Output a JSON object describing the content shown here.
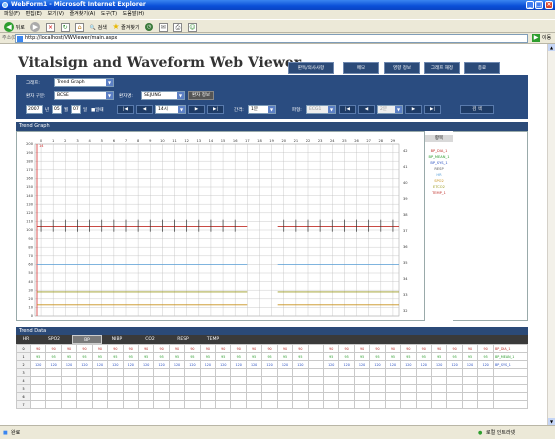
{
  "window": {
    "title": "WebForm1 - Microsoft Internet Explorer",
    "min": "_",
    "max": "□",
    "close": "×"
  },
  "menu": [
    "파일(F)",
    "편집(E)",
    "보기(V)",
    "즐겨찾기(A)",
    "도구(T)",
    "도움말(H)"
  ],
  "toolbar": {
    "back": "뒤로",
    "search": "검색",
    "favorites": "즐겨찾기"
  },
  "address": {
    "label": "주소(D)",
    "url": "http://localhost/VWViewer/main.aspx",
    "go": "이동"
  },
  "app": {
    "title": "Vitalsign and Waveform Web Viewer",
    "top_buttons": [
      "판독/의사사항",
      "메모",
      "영향 정보",
      "그래프 재정",
      "종료"
    ]
  },
  "controls": {
    "graph_label": "그래프:",
    "graph_value": "Trend Graph",
    "patient_group_label": "환자 구분:",
    "patient_group_value": "BCSE",
    "patient_label": "환자명:",
    "patient_value": "SEJUNG",
    "patient_info": "환자 정보",
    "year": "2007",
    "year_unit": "년",
    "month": "05",
    "month_unit": "월",
    "day": "07",
    "day_unit": "일",
    "hour_label": "■일때",
    "time_value": "14시",
    "interval_label": "간격:",
    "interval_value": "1분",
    "wave_label": "파형:",
    "wave_value": "ECG1",
    "wave_interval": "2분",
    "search": "검 색",
    "nav_first": "|◀",
    "nav_prev": "◀",
    "nav_next": "▶",
    "nav_last": "▶|"
  },
  "trend": {
    "heading": "Trend Graph",
    "ticks": [
      "0",
      "1",
      "2",
      "3",
      "4",
      "5",
      "6",
      "7",
      "8",
      "9",
      "10",
      "11",
      "12",
      "13",
      "14",
      "15",
      "16",
      "17",
      "18",
      "19",
      "20",
      "21",
      "22",
      "23",
      "24",
      "25",
      "26",
      "27",
      "28",
      "29"
    ],
    "marker_label": "14",
    "y_ticks": [
      "200",
      "190",
      "180",
      "170",
      "160",
      "150",
      "140",
      "130",
      "120",
      "110",
      "100",
      "90",
      "80",
      "70",
      "60",
      "50",
      "40",
      "30",
      "20",
      "10",
      "0"
    ],
    "right_ticks": [
      "42",
      "41",
      "40",
      "39",
      "38",
      "37",
      "36",
      "35",
      "34",
      "33",
      "32"
    ],
    "legend_title": "항목",
    "legend": [
      "BP_DIA_1",
      "BP_MEAN_1",
      "BP_SYS_1",
      "RESP",
      "HR",
      "SPO2",
      "ETCO2",
      "TEMP_1"
    ],
    "colors": {
      "bp": "#c0302a",
      "hr": "#333333",
      "spo2": "#5aa0d8",
      "resp": "#9a9a20",
      "temp": "#c8901a",
      "marker": "#d43030",
      "grid": "#bfbfbf"
    }
  },
  "chart_data": {
    "type": "line",
    "x": [
      0,
      1,
      2,
      3,
      4,
      5,
      6,
      7,
      8,
      9,
      10,
      11,
      12,
      13,
      14,
      15,
      16,
      17,
      18,
      19,
      20,
      21,
      22,
      23,
      24,
      25,
      26,
      27,
      28,
      29
    ],
    "ylim": [
      0,
      200
    ],
    "gap": [
      17.5,
      20
    ],
    "series": [
      {
        "name": "BP_DIA_1",
        "y": 104
      },
      {
        "name": "SPO2",
        "y": 60
      },
      {
        "name": "RESP",
        "y": 28
      },
      {
        "name": "TEMP_1",
        "y": 13
      }
    ],
    "spike_range": [
      98,
      112
    ]
  },
  "data": {
    "heading": "Trend Data",
    "tabs": [
      "HR",
      "SPO2",
      "BP",
      "NIBP",
      "CO2",
      "RESP",
      "TEMP"
    ],
    "active_tab": 2,
    "rows": [
      {
        "n": "0",
        "v": "90",
        "label": "BP_DIA_1",
        "color": "#c0302a"
      },
      {
        "n": "1",
        "v": "95",
        "label": "BP_MEAN_1",
        "color": "#2a9a2a"
      },
      {
        "n": "2",
        "v": "120",
        "label": "BP_SYS_1",
        "color": "#2a50c0"
      },
      {
        "n": "3",
        "v": "",
        "label": "",
        "color": "#000"
      },
      {
        "n": "4",
        "v": "",
        "label": "",
        "color": "#000"
      },
      {
        "n": "5",
        "v": "",
        "label": "",
        "color": "#000"
      },
      {
        "n": "6",
        "v": "",
        "label": "",
        "color": "#000"
      },
      {
        "n": "7",
        "v": "",
        "label": "",
        "color": "#000"
      }
    ]
  },
  "status": {
    "left": "완료",
    "right": "로컬 인트라넷"
  }
}
